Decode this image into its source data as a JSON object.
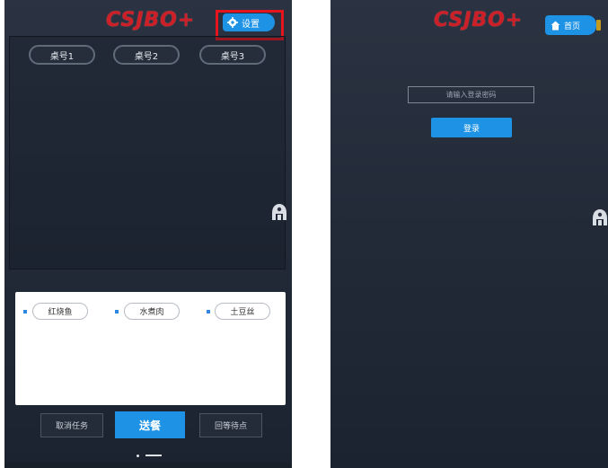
{
  "brand": {
    "logo_text": "CSJBO+"
  },
  "left_screen": {
    "settings_button_label": "设置",
    "tables": [
      {
        "label": "桌号1"
      },
      {
        "label": "桌号2"
      },
      {
        "label": "桌号3"
      }
    ],
    "dishes": [
      {
        "label": "红烧鱼"
      },
      {
        "label": "水煮肉"
      },
      {
        "label": "土豆丝"
      }
    ],
    "bottom_bar": {
      "cancel_label": "取消任务",
      "deliver_label": "送餐",
      "return_label": "回等待点"
    }
  },
  "right_screen": {
    "home_button_label": "首页",
    "password_placeholder": "请输入登录密码",
    "login_label": "登录"
  },
  "colors": {
    "accent": "#1e93e6",
    "logo": "#cc1f27",
    "highlight": "#e4151c",
    "background": "#242c39"
  },
  "icons": {
    "settings": "gear-icon",
    "home": "home-icon",
    "side": "robot-icon"
  }
}
